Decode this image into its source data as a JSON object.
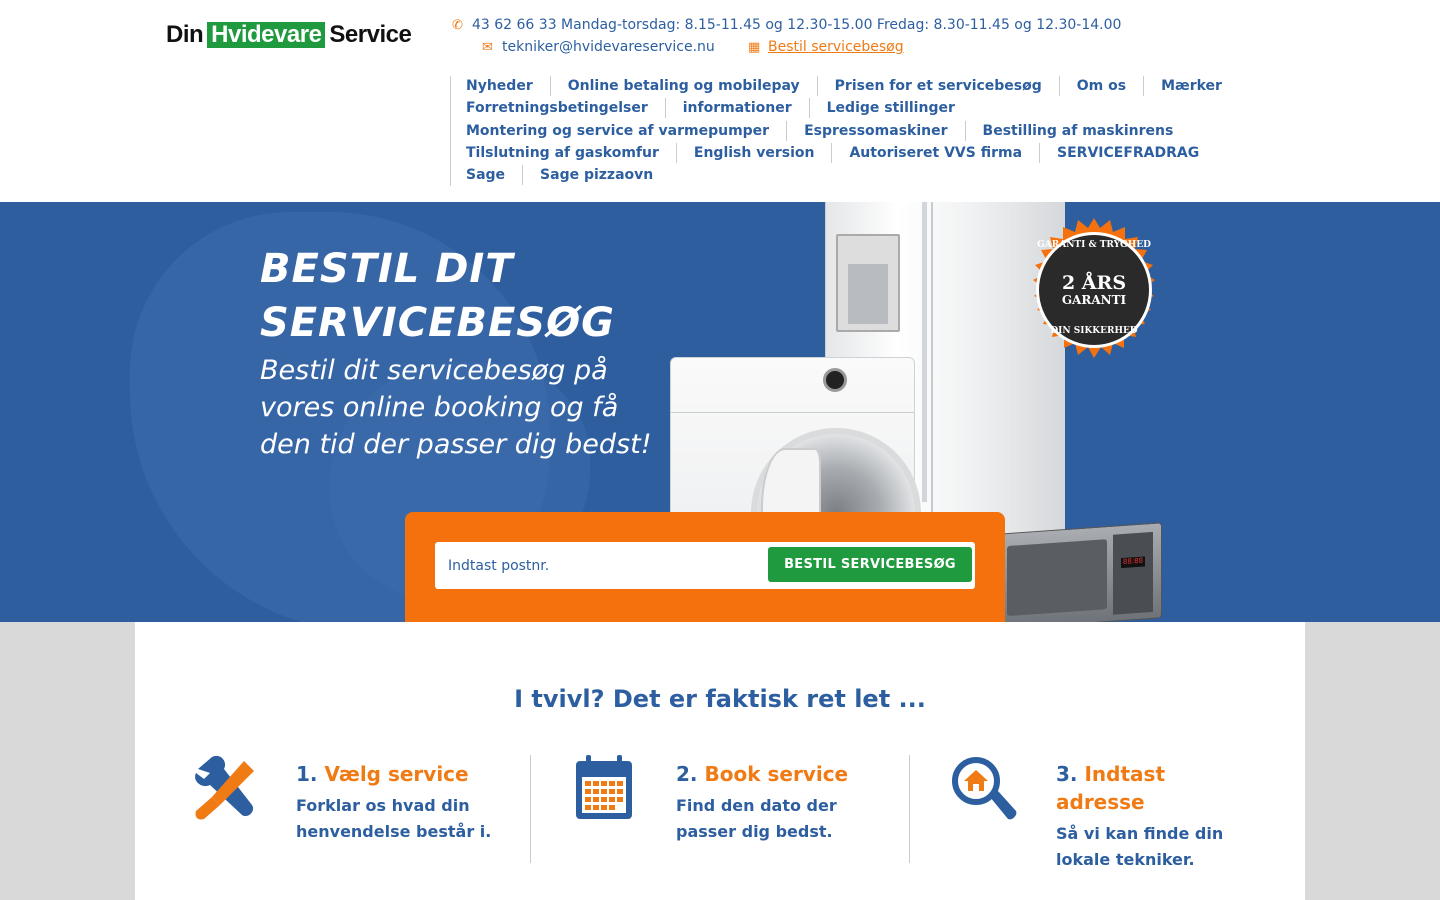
{
  "logo": {
    "part1": "Din",
    "part2": "Hvidevare",
    "part3": "Service"
  },
  "contact": {
    "phone_hours": "43 62 66 33 Mandag-torsdag: 8.15-11.45 og 12.30-15.00 Fredag: 8.30-11.45 og 12.30-14.00",
    "email": "tekniker@hvidevareservice.nu",
    "booking_link": "Bestil servicebesøg"
  },
  "nav": {
    "rows": [
      [
        "Nyheder",
        "Online betaling og mobilepay",
        "Prisen for et servicebesøg",
        "Om os",
        "Mærker"
      ],
      [
        "Forretningsbetingelser",
        "informationer",
        "Ledige stillinger"
      ],
      [
        "Montering og service af varmepumper",
        "Espressomaskiner",
        "Bestilling af maskinrens"
      ],
      [
        "Tilslutning af gaskomfur",
        "English version",
        "Autoriseret VVS firma",
        "SERVICEFRADRAG"
      ],
      [
        "Sage",
        "Sage pizzaovn"
      ]
    ]
  },
  "hero": {
    "title_line1": "BESTIL DIT",
    "title_line2": "SERVICEBESØG",
    "subtitle": "Bestil dit servicebesøg på vores online booking og få den tid der passer dig bedst!",
    "badge": {
      "ring_top": "GARANTI & TRYGHED",
      "big": "2 ÅRS",
      "small": "GARANTI",
      "ring_bottom": "DIN SIKKERHED"
    },
    "microwave_display": "88:88"
  },
  "booking": {
    "placeholder": "Indtast postnr.",
    "button_label": "BESTIL SERVICEBESØG"
  },
  "steps": {
    "title": "I tvivl? Det er faktisk ret let ...",
    "items": [
      {
        "num": "1.",
        "head": "Vælg service",
        "line1": "Forklar os hvad din",
        "line2": "henvendelse består i."
      },
      {
        "num": "2.",
        "head": "Book service",
        "line1": "Find den dato der",
        "line2": "passer dig bedst."
      },
      {
        "num": "3.",
        "head": "Indtast",
        "head2": "adresse",
        "line1": "Så vi kan finde din",
        "line2": "lokale tekniker."
      }
    ]
  },
  "colors": {
    "brand_blue": "#2d5fa0",
    "accent_orange": "#f5710d",
    "brand_green": "#1f9a3e"
  },
  "icons": {
    "phone": "phone-icon",
    "email": "envelope-icon",
    "calendar": "calendar-icon",
    "tools": "tools-icon",
    "search_home": "search-home-icon"
  }
}
